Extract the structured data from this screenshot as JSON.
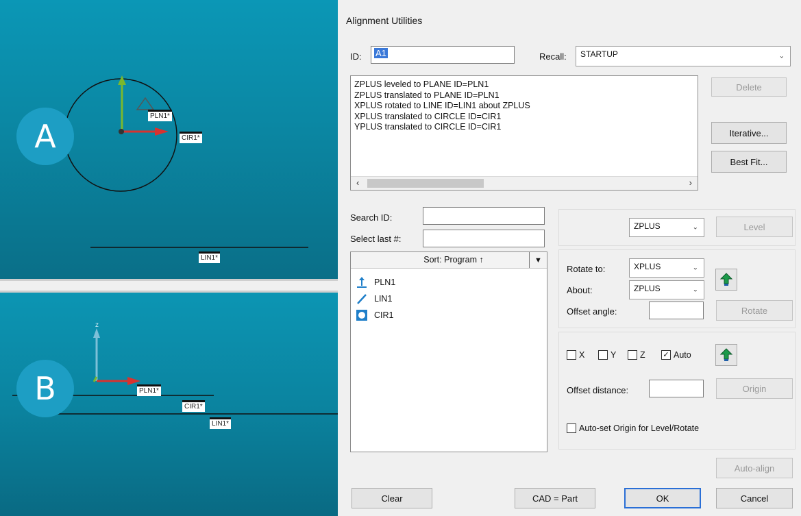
{
  "viewport_a": {
    "badge": "A",
    "labels": {
      "plane": "PLN1*",
      "circle": "CIR1*",
      "line": "LIN1*"
    }
  },
  "viewport_b": {
    "badge": "B",
    "labels": {
      "plane": "PLN1*",
      "circle": "CIR1*",
      "line": "LIN1*"
    }
  },
  "dialog": {
    "title": "Alignment Utilities",
    "id_label": "ID:",
    "id_value": "A1",
    "recall_label": "Recall:",
    "recall_value": "STARTUP",
    "history": [
      "ZPLUS leveled to PLANE ID=PLN1",
      "ZPLUS translated to PLANE ID=PLN1",
      "XPLUS rotated to LINE ID=LIN1 about ZPLUS",
      "XPLUS translated to CIRCLE ID=CIR1",
      "YPLUS translated to CIRCLE ID=CIR1"
    ],
    "buttons": {
      "delete": "Delete",
      "iterative": "Iterative...",
      "best_fit": "Best Fit...",
      "level": "Level",
      "rotate": "Rotate",
      "origin": "Origin",
      "auto_align": "Auto-align",
      "clear": "Clear",
      "cad_part": "CAD = Part",
      "ok": "OK",
      "cancel": "Cancel"
    },
    "search_label": "Search ID:",
    "select_last_label": "Select last #:",
    "sort_label": "Sort: Program ↑",
    "features": [
      {
        "name": "PLN1",
        "icon": "plane-icon"
      },
      {
        "name": "LIN1",
        "icon": "line-icon"
      },
      {
        "name": "CIR1",
        "icon": "circle-icon"
      }
    ],
    "level_axis": "ZPLUS",
    "rotate_to_label": "Rotate to:",
    "rotate_to_value": "XPLUS",
    "about_label": "About:",
    "about_value": "ZPLUS",
    "offset_angle_label": "Offset angle:",
    "checks": {
      "x": "X",
      "y": "Y",
      "z": "Z",
      "auto": "Auto"
    },
    "offset_distance_label": "Offset distance:",
    "auto_set_label": "Auto-set Origin for Level/Rotate"
  }
}
